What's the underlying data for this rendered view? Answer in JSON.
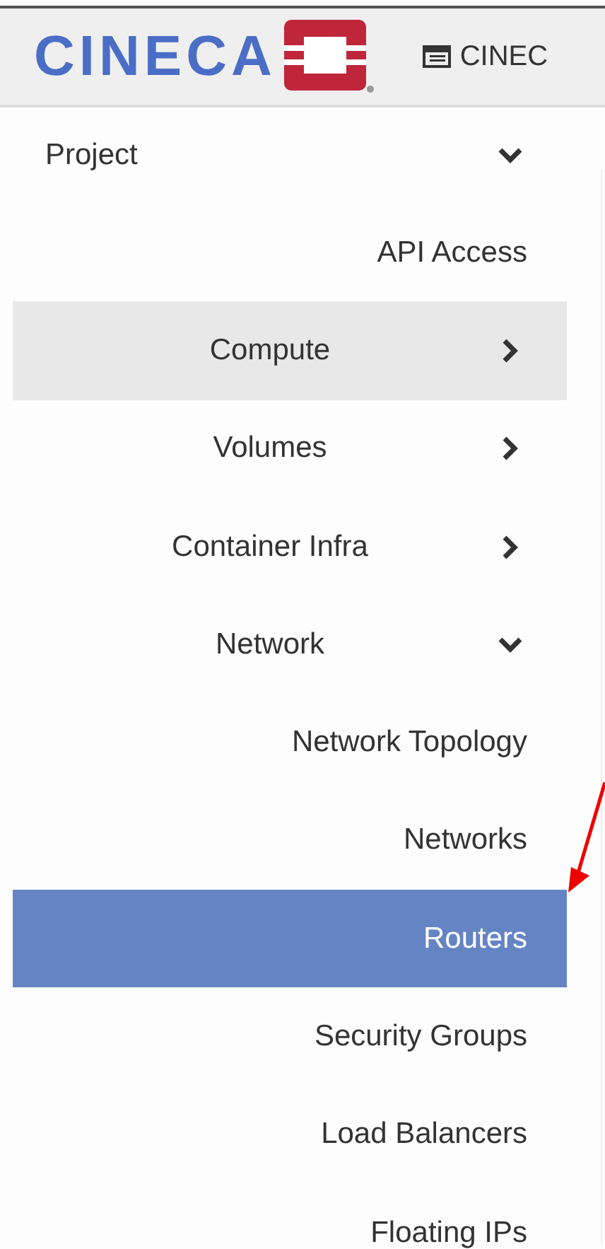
{
  "header": {
    "logo": "CINECA",
    "project_menu": "CINEC"
  },
  "sidebar": {
    "items": [
      {
        "label": "Project",
        "expanded": true,
        "children": [
          {
            "label": "API Access",
            "selected": false,
            "highlighted": false
          },
          {
            "label": "Compute",
            "expanded": false,
            "selected": false,
            "highlighted": true
          },
          {
            "label": "Volumes",
            "expanded": false,
            "selected": false,
            "highlighted": false
          },
          {
            "label": "Container Infra",
            "expanded": false,
            "selected": false,
            "highlighted": false
          },
          {
            "label": "Network",
            "expanded": true,
            "selected": false,
            "highlighted": false,
            "children": [
              {
                "label": "Network Topology",
                "selected": false,
                "highlighted": false
              },
              {
                "label": "Networks",
                "selected": false,
                "highlighted": false
              },
              {
                "label": "Routers",
                "selected": true,
                "highlighted": false
              },
              {
                "label": "Security Groups",
                "selected": false,
                "highlighted": false
              },
              {
                "label": "Load Balancers",
                "selected": false,
                "highlighted": false
              },
              {
                "label": "Floating IPs",
                "selected": false,
                "highlighted": false
              }
            ]
          }
        ]
      }
    ]
  }
}
